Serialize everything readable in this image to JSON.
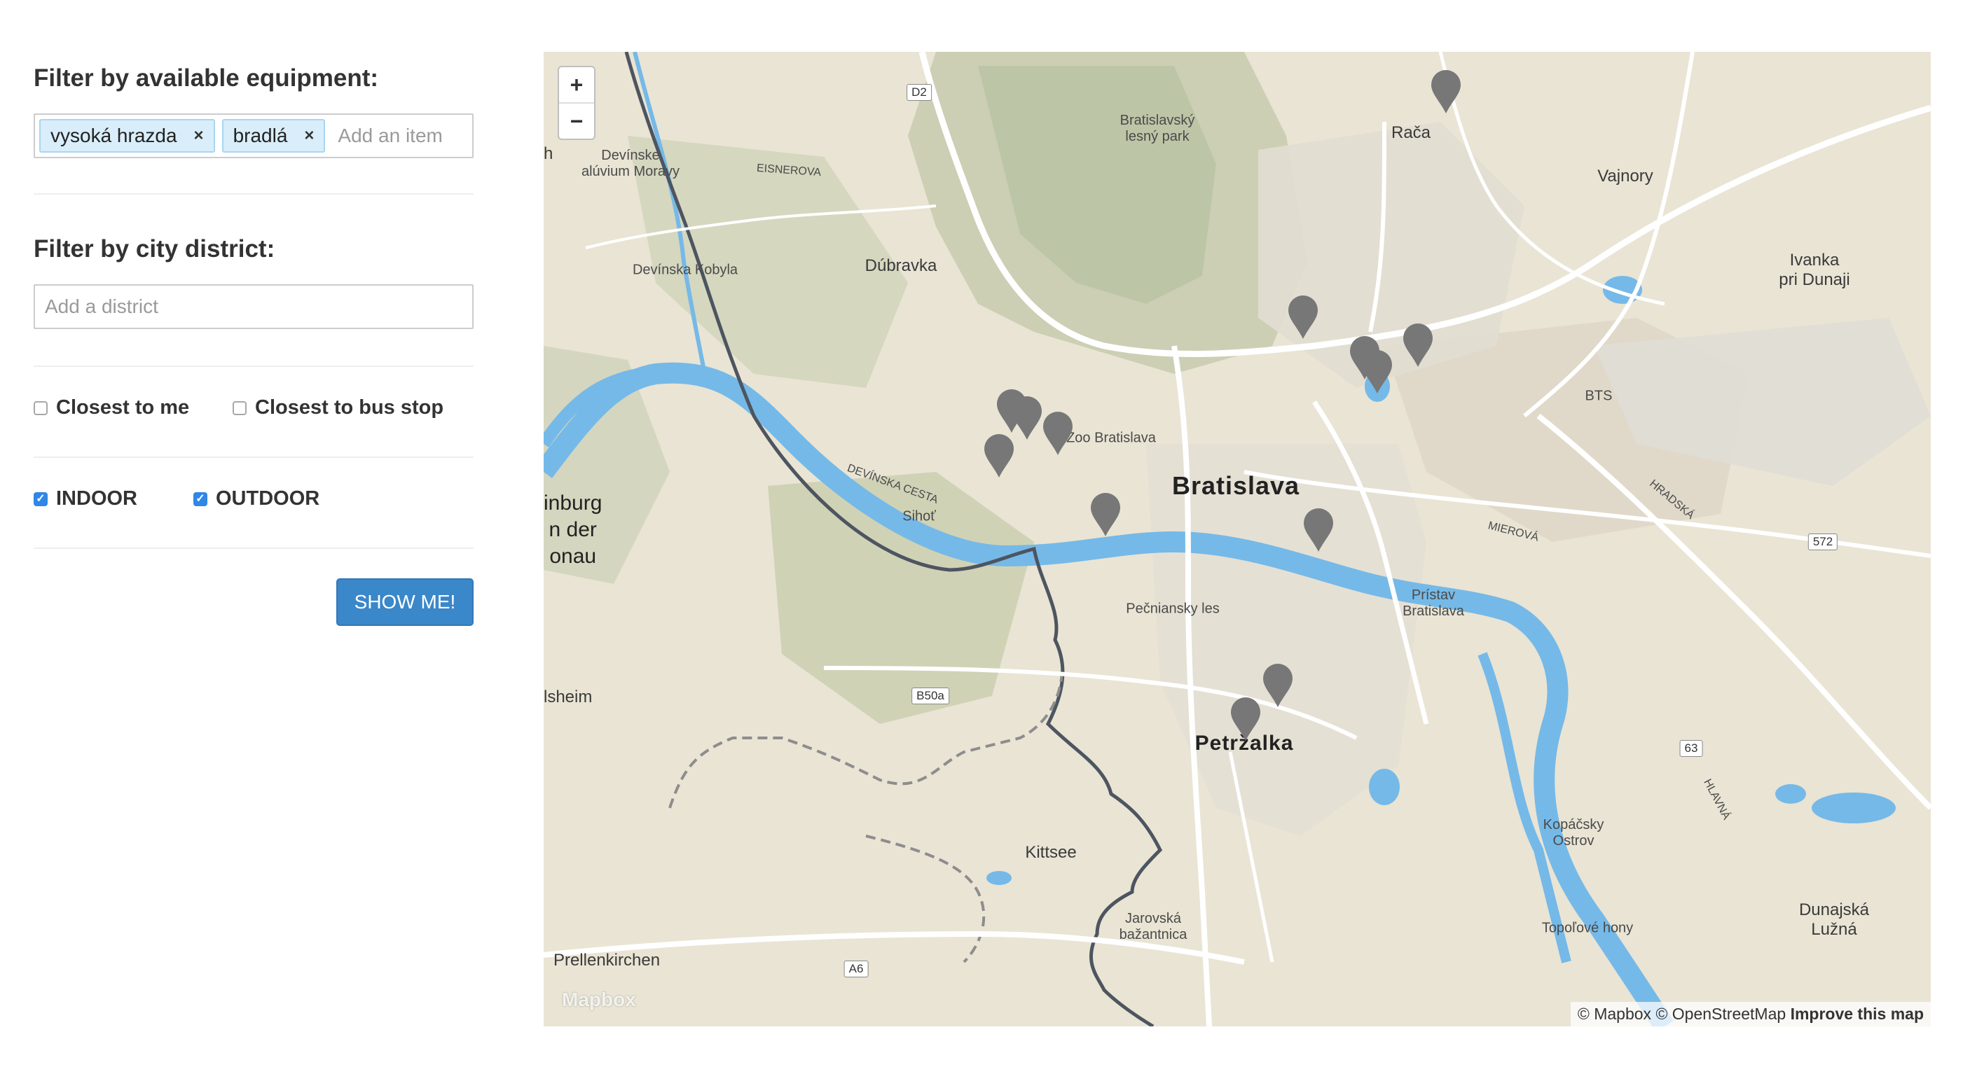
{
  "filters": {
    "equipment": {
      "heading": "Filter by available equipment:",
      "tags": [
        "vysoká hrazda",
        "bradlá"
      ],
      "remove_symbol": "×",
      "placeholder": "Add an item"
    },
    "district": {
      "heading": "Filter by city district:",
      "placeholder": "Add a district"
    },
    "closest_to_me": {
      "label": "Closest to me",
      "checked": false
    },
    "closest_to_bus_stop": {
      "label": "Closest to bus stop",
      "checked": false
    },
    "indoor": {
      "label": "INDOOR",
      "checked": true
    },
    "outdoor": {
      "label": "OUTDOOR",
      "checked": true
    },
    "submit_label": "SHOW ME!"
  },
  "map": {
    "zoom_in": "+",
    "zoom_out": "−",
    "logo": "Mapbox",
    "attribution": {
      "mapbox": "© Mapbox",
      "osm": "© OpenStreetMap",
      "improve": "Improve this map"
    },
    "labels": {
      "bratislava": "Bratislava",
      "petrzalka": "Petržalka",
      "kittsee": "Kittsee",
      "raca": "Rača",
      "vajnory": "Vajnory",
      "ivanka": "Ivanka\npri Dunaji",
      "bts": "BTS",
      "dubravka": "Dúbravka",
      "devinska_kobyla": "Devínska Kobyla",
      "devinske_aluvium": "Devínske\nalúvium Moravy",
      "lesny_park": "Bratislavský\nlesný park",
      "eisnerova": "EISNEROVA",
      "devinska_cesta": "DEVÍNSKA CESTA",
      "sihot": "Sihoť",
      "zoo": "Zoo Bratislava",
      "pecniansky_les": "Pečniansky les",
      "pristav": "Prístav\nBratislava",
      "kopacsky_ostrov": "Kopáčsky\nOstrov",
      "topolove_hony": "Topoľové hony",
      "dunajska_luzna": "Dunajská\nLužná",
      "jarovska": "Jarovská\nbažantnica",
      "prellenkirchen": "Prellenkirchen",
      "hainburg": "inburg\nn der\nonau",
      "edge_h": "h",
      "lsheim": "lsheim",
      "mierova": "MIEROVÁ",
      "hradska": "HRADSKÁ",
      "hlavna": "HLAVNÁ"
    },
    "road_badges": {
      "d2": "D2",
      "b50a": "B50a",
      "a6": "A6",
      "r572": "572",
      "r63": "63"
    },
    "marker_color": "#777777",
    "water_color": "#75b9e8"
  }
}
